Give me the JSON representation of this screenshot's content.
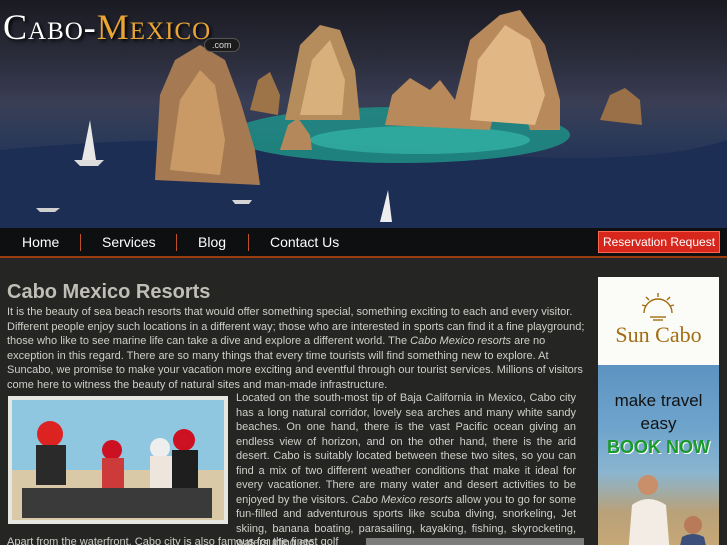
{
  "site": {
    "logo_part1": "Cabo-",
    "logo_part2": "Mexico",
    "logo_suffix": ".com"
  },
  "nav": {
    "items": [
      {
        "label": "Home"
      },
      {
        "label": "Services"
      },
      {
        "label": "Blog"
      },
      {
        "label": "Contact Us"
      }
    ],
    "reservation_label": "Reservation Request"
  },
  "main": {
    "title": "Cabo Mexico Resorts",
    "p1_a": "It is the beauty of sea beach resorts that would offer something special, something exciting to each and every visitor. Different people enjoy such locations in a different way; those who are interested in sports can find it a fine playground; those who like to see marine life can take a dive and explore a different world. The ",
    "p1_em": "Cabo Mexico resorts",
    "p1_b": " are no exception in this regard. There are so many things that every time tourists will find something new to explore. At Suncabo, we promise to make your vacation more exciting and eventful through our tourist services. Millions of visitors come here to witness the beauty of natural sites and man-made infrastructure.",
    "p2_a": "Located on the south-most tip of Baja California in Mexico, Cabo city has a long natural corridor, lovely sea arches and many white sandy beaches. On one hand, there is the vast Pacific ocean giving an endless view of horizon, and on the other hand, there is the arid desert. Cabo is suitably located between these two sites, so you can find a mix of two different weather conditions that make it ideal for every vacationer. There are many water and desert activities to be enjoyed by the visitors. ",
    "p2_em": "Cabo Mexico resorts",
    "p2_b": " allow you to go for some fun-filled and adventurous sports like scuba diving, snorkeling, Jet skiing, banana boating, parasailing, kayaking, fishing, skyrocketing, watersurfing etc.",
    "p3": "Apart from the waterfront, Cabo city is also famous for the finest golf courses"
  },
  "ad": {
    "brand": "Sun Cabo",
    "line1": "make travel",
    "line2": "easy",
    "cta": "BOOK NOW"
  },
  "colors": {
    "accent": "#e9a534",
    "nav_border": "#9b3b12",
    "reserve_bg": "#d7261c",
    "background": "#252524",
    "book_now": "#1b9a2c"
  }
}
